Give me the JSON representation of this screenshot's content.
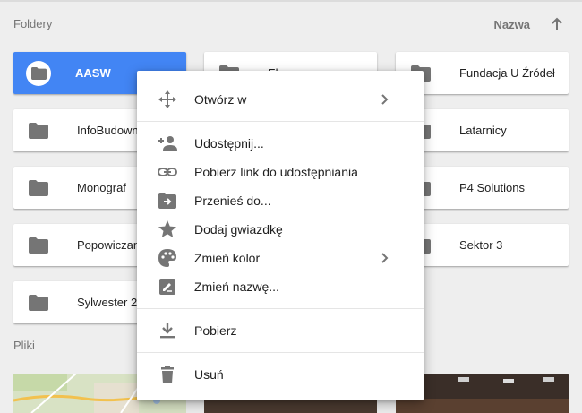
{
  "sections": {
    "folders_label": "Foldery",
    "files_label": "Pliki",
    "sort_label": "Nazwa"
  },
  "folders": [
    {
      "name": "AASW"
    },
    {
      "name": "Ela"
    },
    {
      "name": "Fundacja U Źródeł"
    },
    {
      "name": "InfoBudownictwo"
    },
    {
      "name": "Latarnicy"
    },
    {
      "name": "Monograf"
    },
    {
      "name": "P4 Solutions"
    },
    {
      "name": "Popowiczanie"
    },
    {
      "name": "Sektor 3"
    },
    {
      "name": "Sylwester 2015"
    }
  ],
  "context_menu": {
    "open_with": "Otwórz w",
    "share": "Udostępnij...",
    "get_link": "Pobierz link do udostępniania",
    "move_to": "Przenieś do...",
    "add_star": "Dodaj gwiazdkę",
    "change_color": "Zmień kolor",
    "rename": "Zmień nazwę...",
    "download": "Pobierz",
    "remove": "Usuń"
  },
  "colors": {
    "selected_folder": "#4285f4",
    "icon_grey": "#757575",
    "background": "#eeeeee"
  }
}
